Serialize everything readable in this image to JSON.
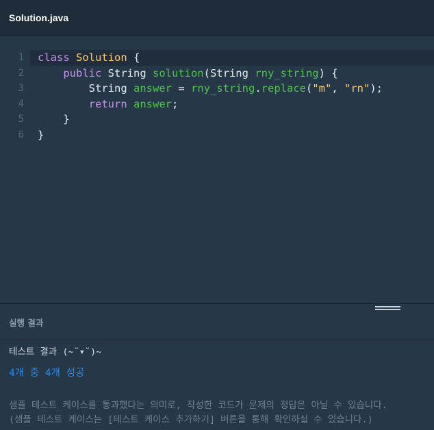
{
  "editor": {
    "tab_title": "Solution.java",
    "lines": [
      {
        "no": "1",
        "indent": "",
        "tokens": [
          [
            "kw",
            "class"
          ],
          [
            "plain",
            " "
          ],
          [
            "cls",
            "Solution"
          ],
          [
            "plain",
            " {"
          ]
        ]
      },
      {
        "no": "2",
        "indent": "    ",
        "tokens": [
          [
            "kw",
            "public"
          ],
          [
            "plain",
            " String "
          ],
          [
            "var",
            "solution"
          ],
          [
            "plain",
            "(String "
          ],
          [
            "var",
            "rny_string"
          ],
          [
            "plain",
            ") {"
          ]
        ]
      },
      {
        "no": "3",
        "indent": "        ",
        "tokens": [
          [
            "plain",
            "String "
          ],
          [
            "var",
            "answer"
          ],
          [
            "plain",
            " = "
          ],
          [
            "var",
            "rny_string"
          ],
          [
            "plain",
            "."
          ],
          [
            "var",
            "replace"
          ],
          [
            "plain",
            "("
          ],
          [
            "str",
            "\"m\""
          ],
          [
            "plain",
            ", "
          ],
          [
            "str",
            "\"rn\""
          ],
          [
            "plain",
            ");"
          ]
        ]
      },
      {
        "no": "4",
        "indent": "        ",
        "tokens": [
          [
            "kw",
            "return"
          ],
          [
            "plain",
            " "
          ],
          [
            "var",
            "answer"
          ],
          [
            "plain",
            ";"
          ]
        ]
      },
      {
        "no": "5",
        "indent": "    ",
        "tokens": [
          [
            "plain",
            "}"
          ]
        ]
      },
      {
        "no": "6",
        "indent": "",
        "tokens": [
          [
            "plain",
            "}"
          ]
        ]
      }
    ]
  },
  "result": {
    "header": "실행 결과",
    "title": "테스트 결과 (~˘▾˘)~",
    "summary": "4개 중 4개 성공",
    "note_line1": "샘플 테스트 케이스를 통과했다는 의미로, 작성한 코드가 문제의 정답은 아닐 수 있습니다.",
    "note_line2": "(샘플 테스트 케이스는 [테스트 케이스 추가하기] 버튼을 통해 확인하실 수 있습니다.)"
  },
  "colors": {
    "background": "#263747",
    "keyword": "#c792ea",
    "class_name": "#ffcb6b",
    "identifier": "#4ec44e",
    "string": "#ffcb6b",
    "success": "#1a8cff"
  }
}
